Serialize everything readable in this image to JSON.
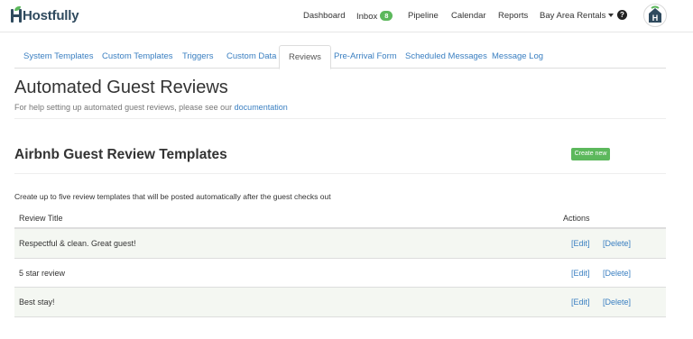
{
  "brand": {
    "name": "Hostfully",
    "accent": "#5cb85c",
    "logo_color": "#2f4a5e",
    "avatar_letter": "H"
  },
  "nav": {
    "dashboard": "Dashboard",
    "inbox": "Inbox",
    "inbox_count": "8",
    "pipeline": "Pipeline",
    "calendar": "Calendar",
    "reports": "Reports",
    "agency": "Bay Area Rentals",
    "help_icon": "question-circle-icon"
  },
  "tabs": [
    {
      "label": "System Templates"
    },
    {
      "label": "Custom Templates"
    },
    {
      "label": "Triggers"
    },
    {
      "label": "Custom Data"
    },
    {
      "label": "Reviews",
      "active": true
    },
    {
      "label": "Pre-Arrival Form"
    },
    {
      "label": "Scheduled Messages"
    },
    {
      "label": "Message Log"
    }
  ],
  "page": {
    "title": "Automated Guest Reviews",
    "help_prefix": "For help setting up automated guest reviews, please see our",
    "help_link": "documentation"
  },
  "section": {
    "title": "Airbnb Guest Review Templates",
    "create_label": "Create new",
    "intro": "Create up to five review templates that will be posted automatically after the guest checks out"
  },
  "table": {
    "col_title": "Review Title",
    "col_actions": "Actions",
    "edit_label": "[Edit]",
    "delete_label": "[Delete]",
    "rows": [
      {
        "title": "Respectful & clean. Great guest!"
      },
      {
        "title": "5 star review"
      },
      {
        "title": "Best stay!"
      }
    ]
  }
}
